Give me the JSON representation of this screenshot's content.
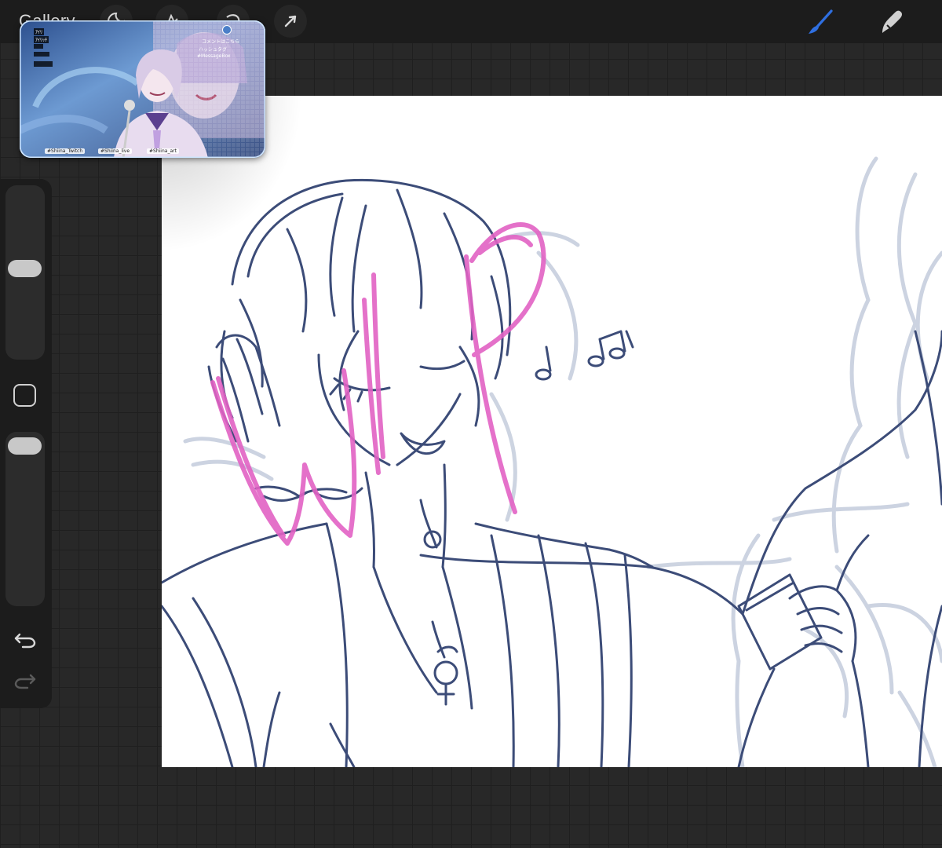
{
  "topbar": {
    "gallery_label": "Gallery",
    "tools_left": [
      {
        "name": "adjustments-icon"
      },
      {
        "name": "selection-icon"
      },
      {
        "name": "transform-icon"
      },
      {
        "name": "arrow-icon"
      }
    ],
    "tools_right": [
      {
        "name": "brush-icon",
        "active": true
      },
      {
        "name": "smudge-icon",
        "active": false
      }
    ]
  },
  "reference": {
    "hud_tags": [
      "ｱｲﾘ",
      "ｱｲﾘｯﾁ"
    ],
    "overlay_lines": [
      "コメントはこちら",
      "ハッシュタグ",
      "#MessageBox"
    ],
    "bottom_tags": [
      "#Shiina_Twitch",
      "#Shiina_live",
      "#Shiina_art"
    ]
  },
  "canvas": {
    "wip_text": "WIP",
    "line_color": "#3c4c78",
    "ghost_color": "#c4ccdc",
    "wip_color": "#e262c4"
  },
  "colors": {
    "accent": "#2f6fe0",
    "toolbar": "#1c1c1c",
    "background": "#282828"
  }
}
